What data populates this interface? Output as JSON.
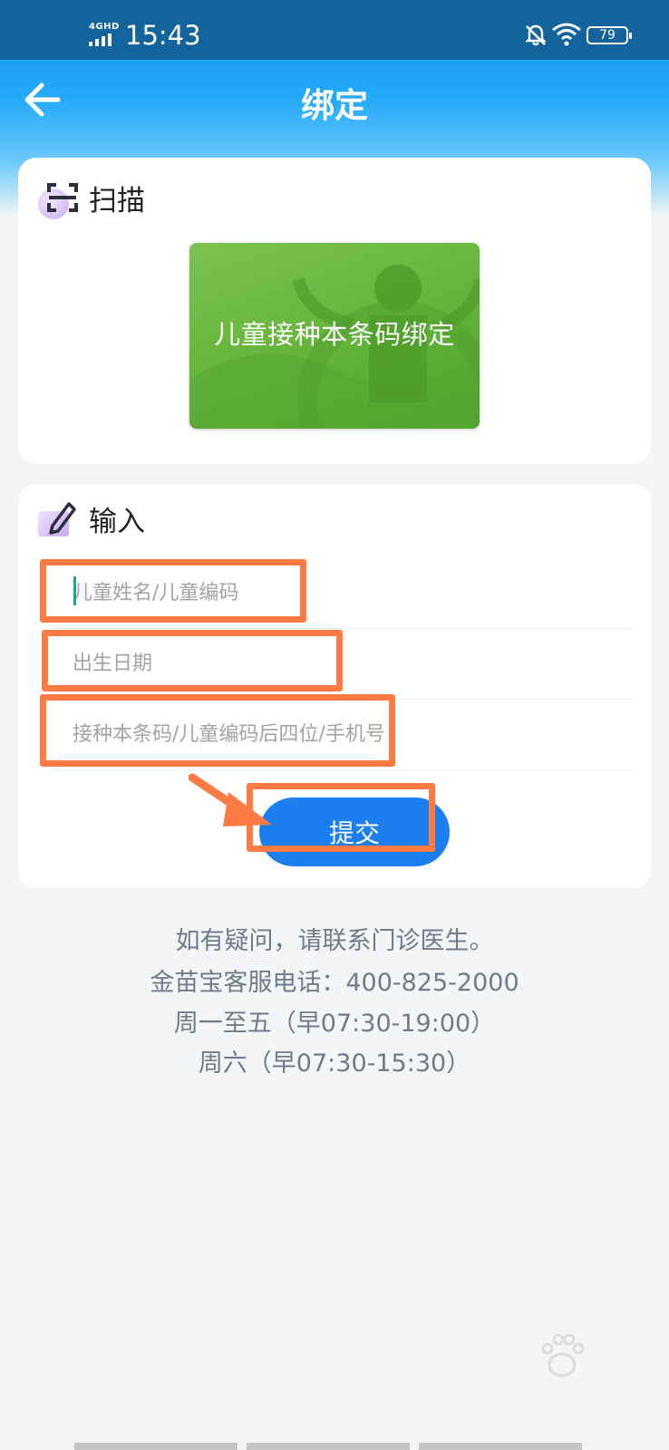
{
  "status_bar": {
    "network": "4GHD",
    "time": "15:43",
    "battery": "79"
  },
  "header": {
    "title": "绑定",
    "back_icon": "back-arrow-icon"
  },
  "scan_section": {
    "title": "扫描",
    "icon": "scan-icon",
    "banner_text": "儿童接种本条码绑定"
  },
  "input_section": {
    "title": "输入",
    "icon": "edit-icon",
    "fields": [
      {
        "placeholder": "儿童姓名/儿童编码",
        "value": ""
      },
      {
        "placeholder": "出生日期",
        "value": ""
      },
      {
        "placeholder": "接种本条码/儿童编码后四位/手机号",
        "value": ""
      }
    ],
    "submit_label": "提交"
  },
  "help": {
    "line1": "如有疑问，请联系门诊医生。",
    "line2": "金苗宝客服电话：400-825-2000",
    "line3": "周一至五（早07:30-19:00）",
    "line4": "周六（早07:30-15:30）"
  },
  "colors": {
    "header": "#23a9f8",
    "status_bar": "#13649c",
    "accent_button": "#1b7ff0",
    "highlight": "#ff7b43",
    "banner_green": "#63b33a"
  }
}
